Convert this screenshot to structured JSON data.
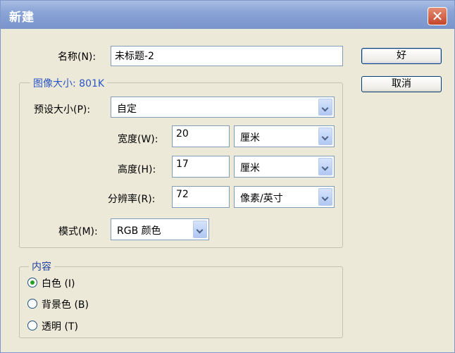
{
  "window": {
    "title": "新建",
    "close_glyph": "✕"
  },
  "name_field": {
    "label": "名称(N):",
    "value": "未标题-2"
  },
  "buttons": {
    "ok": "好",
    "cancel": "取消"
  },
  "image_size": {
    "group_title": "图像大小: 801K",
    "preset": {
      "label": "预设大小(P):",
      "value": "自定"
    },
    "width": {
      "label": "宽度(W):",
      "value": "20",
      "unit": "厘米"
    },
    "height": {
      "label": "高度(H):",
      "value": "17",
      "unit": "厘米"
    },
    "resolution": {
      "label": "分辨率(R):",
      "value": "72",
      "unit": "像素/英寸"
    },
    "mode": {
      "label": "模式(M):",
      "value": "RGB 颜色"
    }
  },
  "contents": {
    "group_title": "内容",
    "options": [
      {
        "label": "白色 (I)",
        "checked": true
      },
      {
        "label": "背景色 (B)",
        "checked": false
      },
      {
        "label": "透明 (T)",
        "checked": false
      }
    ]
  }
}
